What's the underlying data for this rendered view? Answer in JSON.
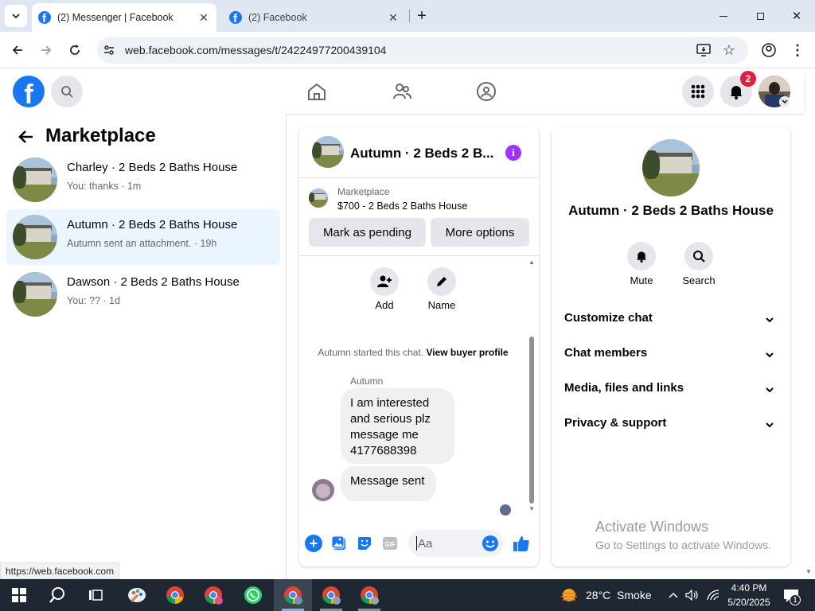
{
  "browser": {
    "tabs": [
      {
        "title": "(2) Messenger | Facebook"
      },
      {
        "title": "(2) Facebook"
      }
    ],
    "url": "web.facebook.com/messages/t/24224977200439104",
    "status_url": "https://web.facebook.com"
  },
  "fb_header": {
    "notification_count": "2"
  },
  "sidebar": {
    "title": "Marketplace",
    "conversations": [
      {
        "title": "Charley · 2 Beds 2 Baths House",
        "subtitle": "You: thanks · 1m"
      },
      {
        "title": "Autumn · 2 Beds 2 Baths House",
        "subtitle": "Autumn sent an attachment. · 19h"
      },
      {
        "title": "Dawson · 2 Beds 2 Baths House",
        "subtitle": "You: ?? · 1d"
      }
    ]
  },
  "chat": {
    "header_title": "Autumn · 2 Beds 2 B...",
    "listing_source": "Marketplace",
    "listing_title": "$700 - 2 Beds 2 Baths House",
    "mark_pending": "Mark as pending",
    "more_options": "More options",
    "add_label": "Add",
    "name_label": "Name",
    "started_text": "Autumn started this chat.",
    "buyer_profile": "View buyer profile",
    "sender_name": "Autumn",
    "messages": [
      {
        "lines": [
          "I am interested",
          "and serious plz",
          "message me",
          "4177688398"
        ]
      },
      {
        "lines": [
          "Message sent"
        ]
      }
    ],
    "composer_placeholder": "Aa"
  },
  "info_panel": {
    "title": "Autumn · 2 Beds 2 Baths House",
    "mute": "Mute",
    "search": "Search",
    "sections": [
      "Customize chat",
      "Chat members",
      "Media, files and links",
      "Privacy & support"
    ],
    "activate_title": "Activate Windows",
    "activate_sub": "Go to Settings to activate Windows."
  },
  "taskbar": {
    "weather": "28°C  Smoke",
    "time": "4:40 PM",
    "date": "5/20/2025",
    "notif_count": "1"
  },
  "colors": {
    "fb_blue": "#1877f2",
    "purple": "#a033ff",
    "badge_red": "#e41e3f",
    "selected_bg": "#ebf5ff",
    "taskbar": "#1f2733"
  }
}
